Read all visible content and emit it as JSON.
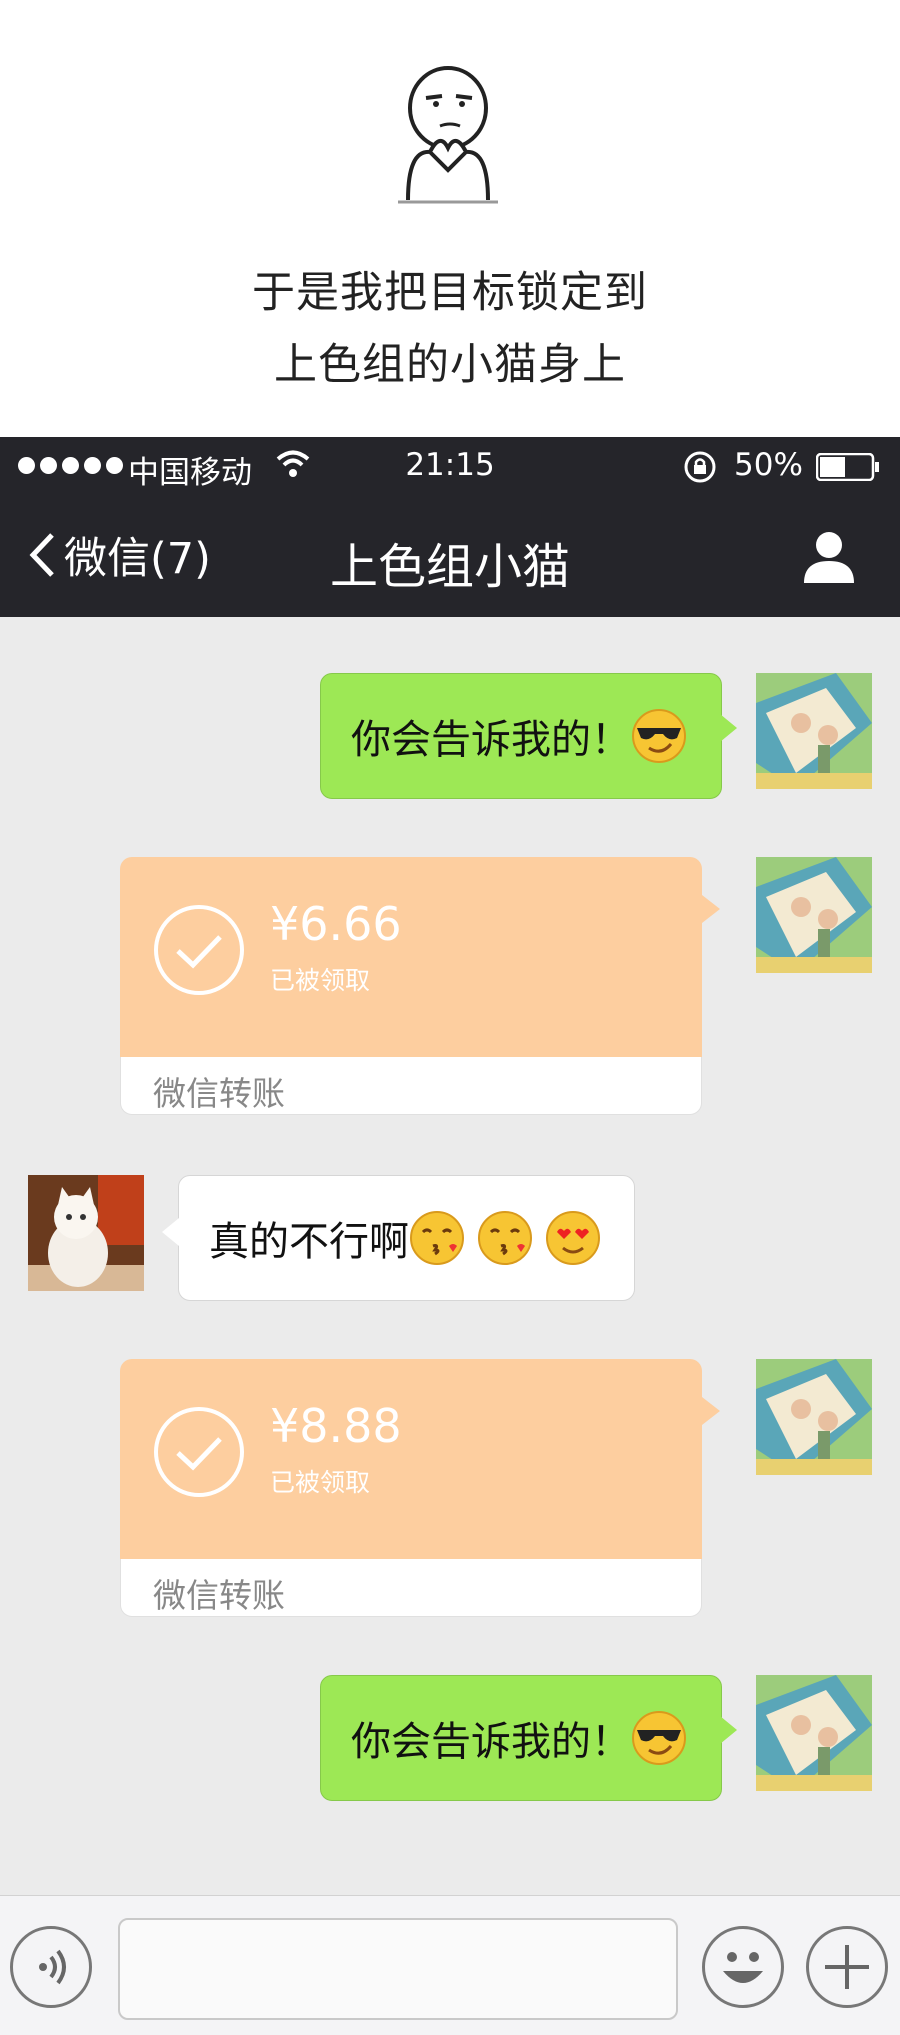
{
  "caption": {
    "line1": "于是我把目标锁定到",
    "line2": "上色组的小猫身上"
  },
  "status_bar": {
    "carrier": "中国移动",
    "time": "21:15",
    "battery": "50%"
  },
  "nav": {
    "back_label": "微信(7)",
    "title": "上色组小猫"
  },
  "messages": [
    {
      "side": "right",
      "type": "text",
      "text": "你会告诉我的！",
      "emoji": [
        "cool-sunglasses"
      ]
    },
    {
      "side": "right",
      "type": "transfer",
      "amount": "¥6.66",
      "status": "已被领取",
      "label": "微信转账"
    },
    {
      "side": "left",
      "type": "text",
      "text": "真的不行啊",
      "emoji": [
        "kiss",
        "kiss",
        "heart-eyes"
      ]
    },
    {
      "side": "right",
      "type": "transfer",
      "amount": "¥8.88",
      "status": "已被领取",
      "label": "微信转账"
    },
    {
      "side": "right",
      "type": "text",
      "text": "你会告诉我的！",
      "emoji": [
        "cool-sunglasses"
      ]
    }
  ],
  "colors": {
    "header_bg": "#25252a",
    "chat_bg": "#ebebeb",
    "sent_bubble": "#9de855",
    "transfer_card": "#fdce9f"
  }
}
